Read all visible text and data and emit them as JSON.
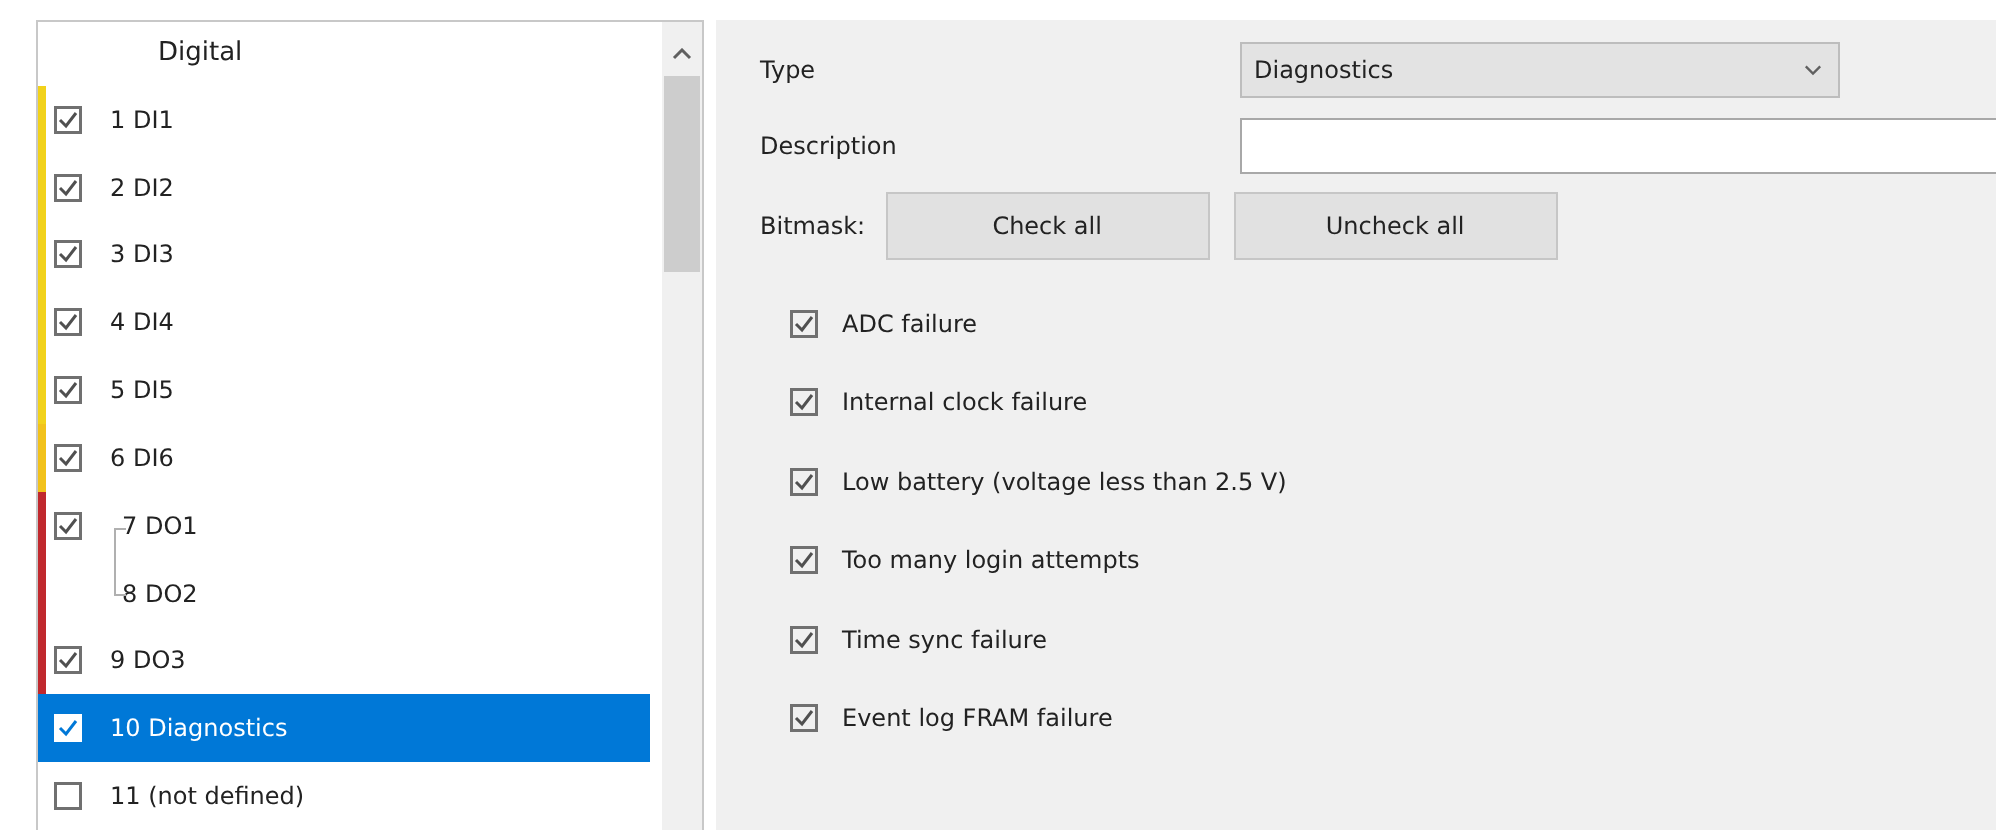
{
  "channel_list": {
    "header": "Digital",
    "items": [
      {
        "label": "1 DI1",
        "checked": true,
        "selected": false,
        "color": "#f2d21b",
        "kind": "normal"
      },
      {
        "label": "2 DI2",
        "checked": true,
        "selected": false,
        "color": "#f2d21b",
        "kind": "normal"
      },
      {
        "label": "3 DI3",
        "checked": true,
        "selected": false,
        "color": "#f2d21b",
        "kind": "normal"
      },
      {
        "label": "4 DI4",
        "checked": true,
        "selected": false,
        "color": "#f2d21b",
        "kind": "normal"
      },
      {
        "label": "5 DI5",
        "checked": true,
        "selected": false,
        "color": "#f2d21b",
        "kind": "normal"
      },
      {
        "label": "6 DI6",
        "checked": true,
        "selected": false,
        "color": "#f2c21b",
        "kind": "normal"
      },
      {
        "label": "7 DO1",
        "checked": true,
        "selected": false,
        "color": "#c0282d",
        "kind": "group-top"
      },
      {
        "label": "8 DO2",
        "selected": false,
        "color": "#c0282d",
        "kind": "group-bottom"
      },
      {
        "label": "9 DO3",
        "checked": true,
        "selected": false,
        "color": "#c0282d",
        "kind": "normal"
      },
      {
        "label": "10 Diagnostics",
        "checked": true,
        "selected": true,
        "kind": "normal"
      },
      {
        "label": "11 (not defined)",
        "checked": false,
        "selected": false,
        "kind": "normal"
      }
    ]
  },
  "form": {
    "type_label": "Type",
    "type_value": "Diagnostics",
    "description_label": "Description",
    "bitmask_label": "Bitmask:",
    "buttons": [
      "Check all",
      "Uncheck all"
    ],
    "options": [
      {
        "label": "ADC failure",
        "checked": true
      },
      {
        "label": "Internal clock failure",
        "checked": true
      },
      {
        "label": "Low battery (voltage less than 2.5 V)",
        "checked": true
      },
      {
        "label": "Too many login attempts",
        "checked": true
      },
      {
        "label": "Time sync failure",
        "checked": true
      },
      {
        "label": "Event log FRAM failure",
        "checked": true
      }
    ]
  }
}
